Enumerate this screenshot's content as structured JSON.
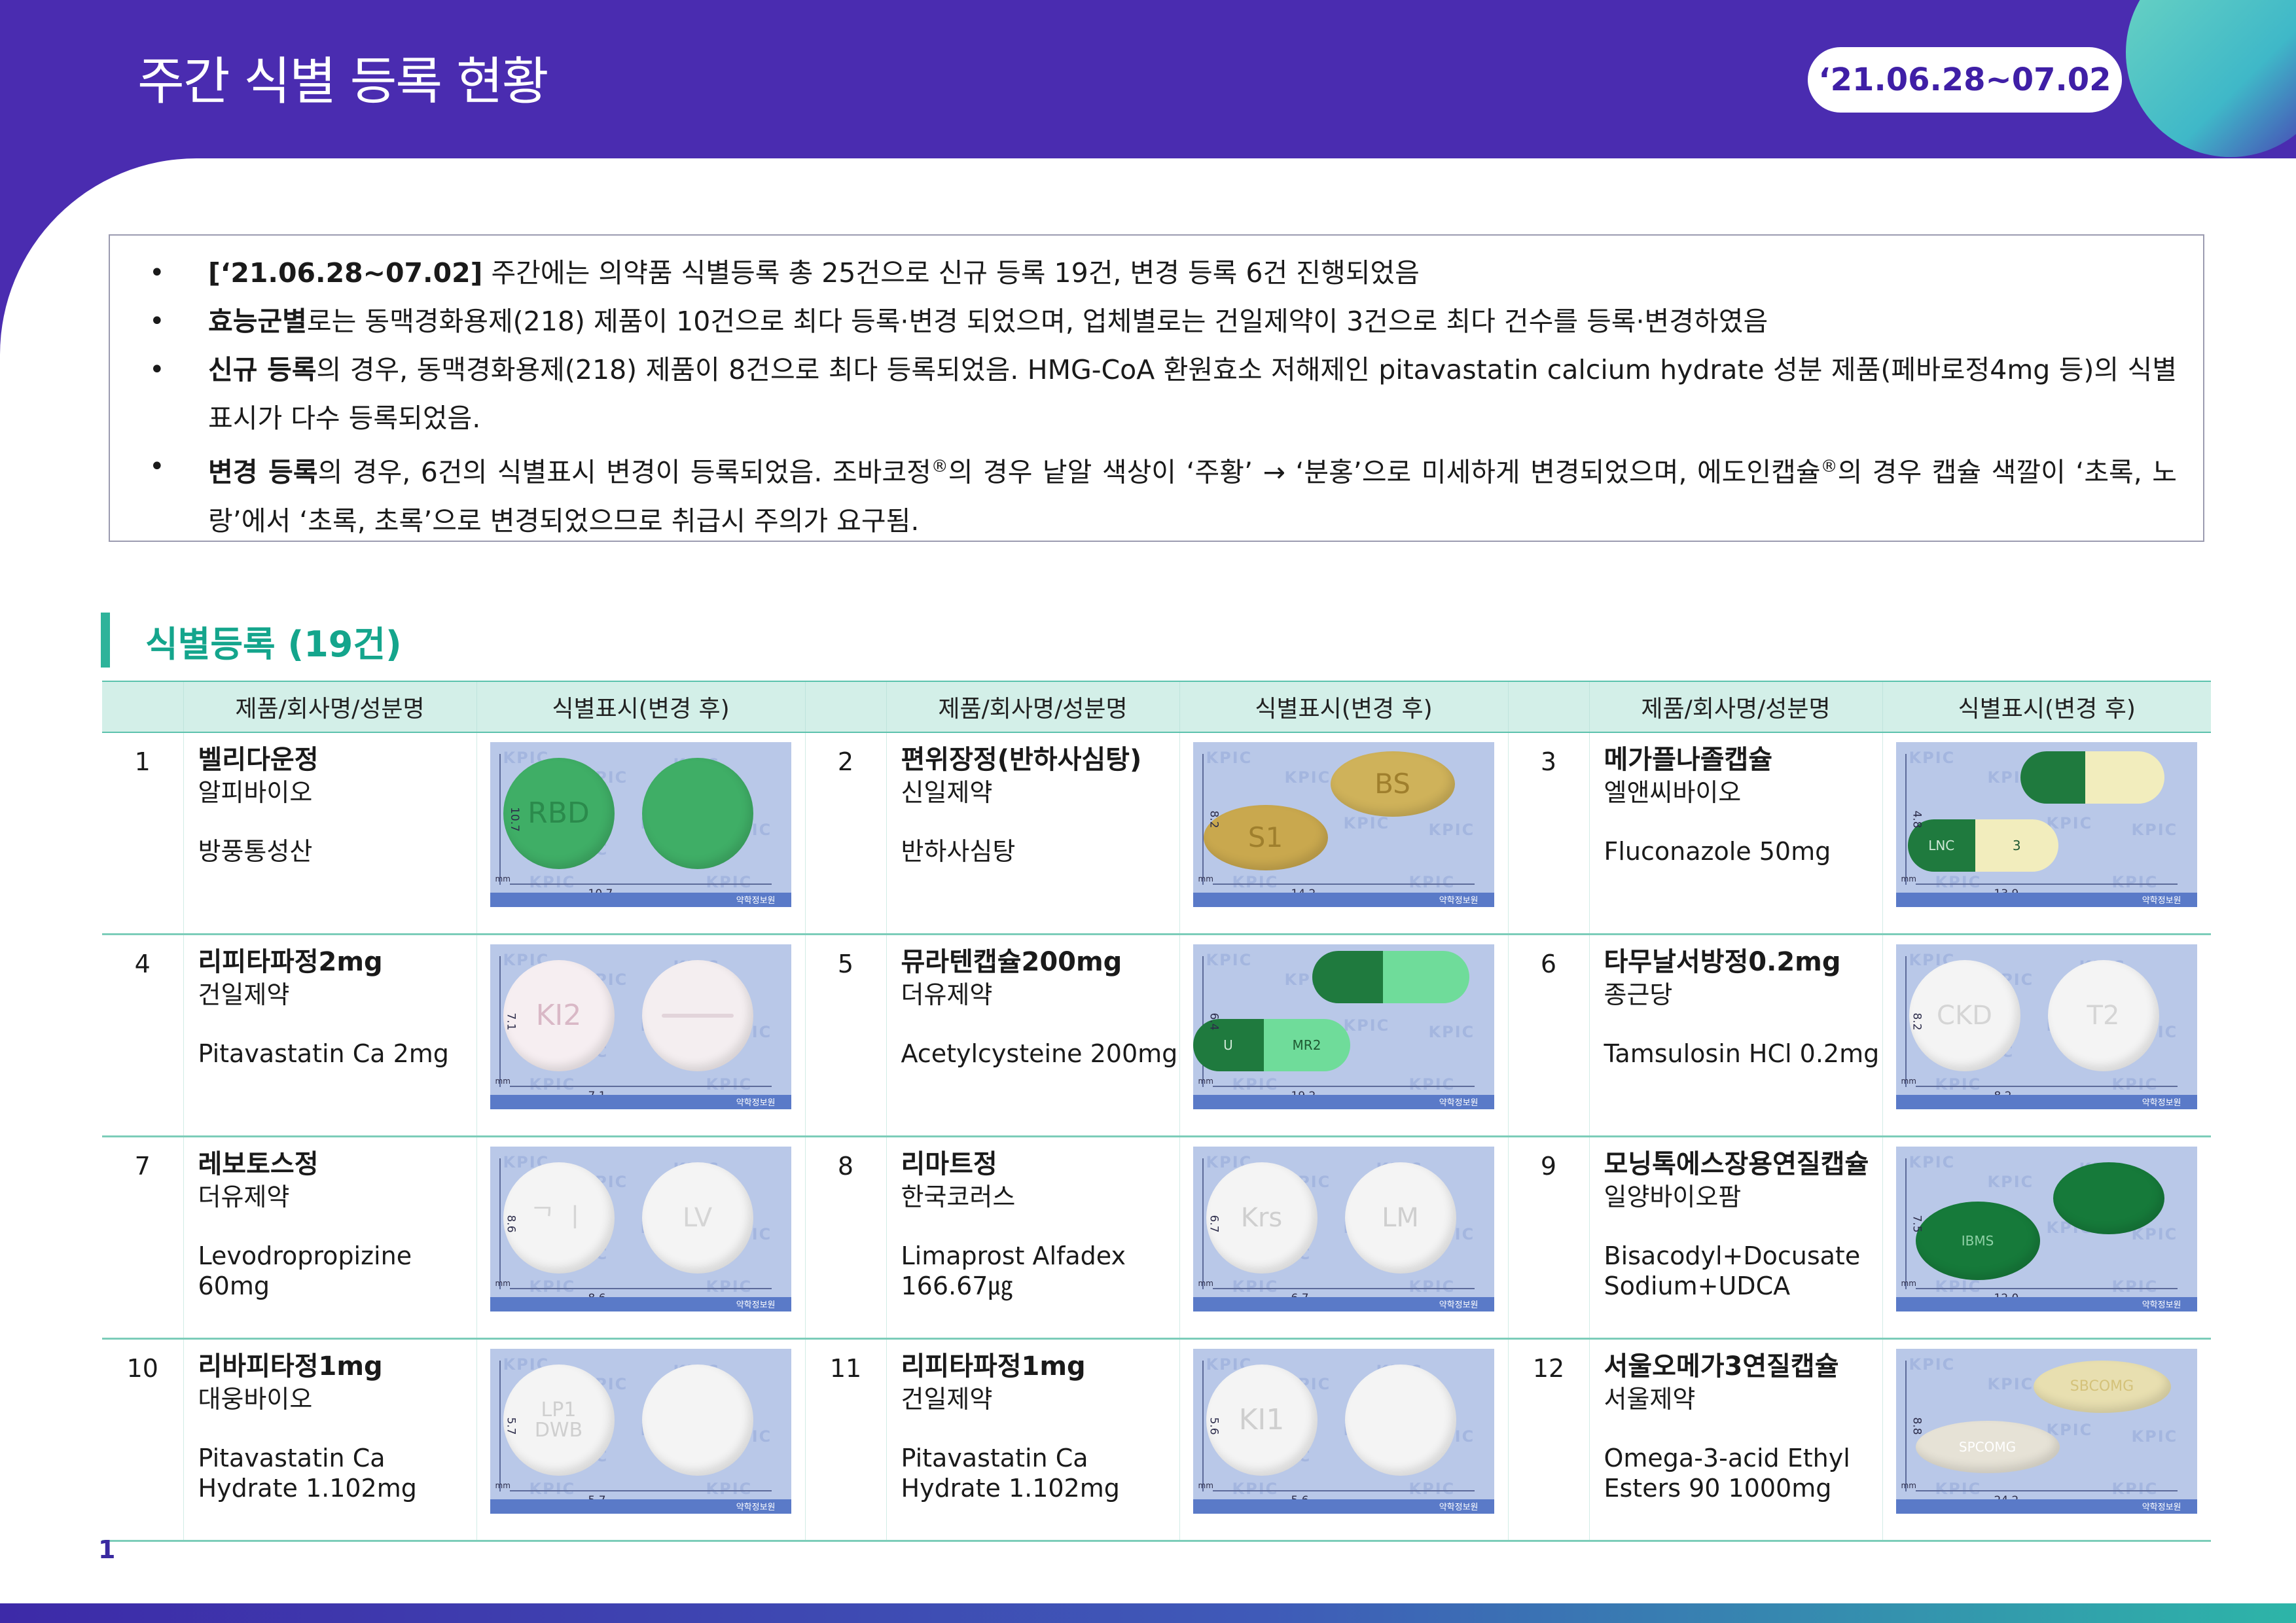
{
  "header": {
    "title": "주간 식별 등록 현황",
    "date_badge": "‘21.06.28~07.02"
  },
  "summary": {
    "b1": {
      "bold": "[‘21.06.28~07.02]",
      "text": " 주간에는 의약품 식별등록 총 25건으로 신규 등록 19건, 변경 등록 6건 진행되었음"
    },
    "b2": {
      "bold": "효능군별",
      "text": "로는 동맥경화용제(218) 제품이 10건으로 최다 등록·변경 되었으며, 업체별로는 건일제약이 3건으로 최다 건수를 등록·변경하였음"
    },
    "b3": {
      "bold": "신규 등록",
      "text": "의 경우, 동맥경화용제(218) 제품이 8건으로 최다 등록되었음. HMG-CoA 환원효소 저해제인 pitavastatin calcium hydrate 성분 제품(페바로정4mg 등)의 식별표시가 다수 등록되었음."
    },
    "b4": {
      "bold": "변경 등록",
      "text_a": "의 경우, 6건의 식별표시 변경이 등록되었음. 조바코정",
      "reg": "®",
      "text_b": "의 경우 낱알 색상이 ‘주황’ → ‘분홍’으로 미세하게 변경되었으며, 에도인캡슐",
      "text_c": "의 경우 캡슐 색깔이 ‘초록, 노랑’에서 ‘초록, 초록’으로 변경되었으므로 취급시 주의가 요구됨."
    }
  },
  "section": {
    "title": "식별등록 (19건)"
  },
  "table": {
    "headers": {
      "product": "제품/회사명/성분명",
      "mark": "식별표시(변경 후)"
    },
    "watermark": "KPIC",
    "footer": "약학정보원",
    "mm": "mm",
    "rows": [
      [
        {
          "no": "1",
          "name": "벨리다운정",
          "company": "알피바이오",
          "ingredient": "방풍통성산",
          "w": "10.7",
          "h": "10.7",
          "marks": [
            "RBD",
            ""
          ]
        },
        {
          "no": "2",
          "name": "편위장정(반하사심탕)",
          "company": "신일제약",
          "ingredient": "반하사심탕",
          "w": "14.2",
          "h": "8.2",
          "marks": [
            "S1",
            "BS"
          ]
        },
        {
          "no": "3",
          "name": "메가플나졸캡슐",
          "company": "엘앤씨바이오",
          "ingredient": "Fluconazole 50mg",
          "w": "13.9",
          "h": "4.8",
          "marks": [
            "LNC",
            "3"
          ]
        }
      ],
      [
        {
          "no": "4",
          "name": "리피타파정2mg",
          "company": "건일제약",
          "ingredient": "Pitavastatin Ca 2mg",
          "w": "7.1",
          "h": "7.1",
          "marks": [
            "KI2",
            ""
          ]
        },
        {
          "no": "5",
          "name": "뮤라텐캡슐200mg",
          "company": "더유제약",
          "ingredient": "Acetylcysteine 200mg",
          "w": "19.2",
          "h": "6.4",
          "marks": [
            "U",
            "MR2"
          ]
        },
        {
          "no": "6",
          "name": "타무날서방정0.2mg",
          "company": "종근당",
          "ingredient": "Tamsulosin HCl 0.2mg",
          "w": "8.2",
          "h": "8.2",
          "marks": [
            "CKD",
            "T2"
          ]
        }
      ],
      [
        {
          "no": "7",
          "name": "레보토스정",
          "company": "더유제약",
          "ingredient": "Levodropropizine 60mg",
          "w": "8.6",
          "h": "8.6",
          "marks": [
            "ᄀ ㅣ",
            "LV"
          ]
        },
        {
          "no": "8",
          "name": "리마트정",
          "company": "한국코러스",
          "ingredient": "Limaprost Alfadex 166.67㎍",
          "w": "6.7",
          "h": "6.7",
          "marks": [
            "Krs",
            "LM"
          ]
        },
        {
          "no": "9",
          "name": "모닝톡에스장용연질캡슐",
          "company": "일양바이오팜",
          "ingredient": "Bisacodyl+Docusate Sodium+UDCA",
          "w": "12.0",
          "h": "7.5",
          "marks": [
            "IBMS",
            ""
          ]
        }
      ],
      [
        {
          "no": "10",
          "name": "리바피타정1mg",
          "company": "대웅바이오",
          "ingredient": "Pitavastatin Ca Hydrate 1.102mg",
          "w": "5.7",
          "h": "5.7",
          "marks": [
            "LP1\nDWB",
            ""
          ]
        },
        {
          "no": "11",
          "name": "리피타파정1mg",
          "company": "건일제약",
          "ingredient": "Pitavastatin Ca Hydrate 1.102mg",
          "w": "5.6",
          "h": "5.6",
          "marks": [
            "KI1",
            ""
          ]
        },
        {
          "no": "12",
          "name": "서울오메가3연질캡슐",
          "company": "서울제약",
          "ingredient": "Omega-3-acid Ethyl Esters 90 1000mg",
          "w": "24.2",
          "h": "8.8",
          "marks": [
            "SPCOMG",
            "SBCOMG"
          ]
        }
      ]
    ]
  },
  "page_number": "1",
  "colors": {
    "header_purple": "#4a2cb0",
    "accent_teal": "#2eb39a",
    "table_header_bg": "#d3efe8",
    "photo_bg": "#b9c8e8"
  }
}
